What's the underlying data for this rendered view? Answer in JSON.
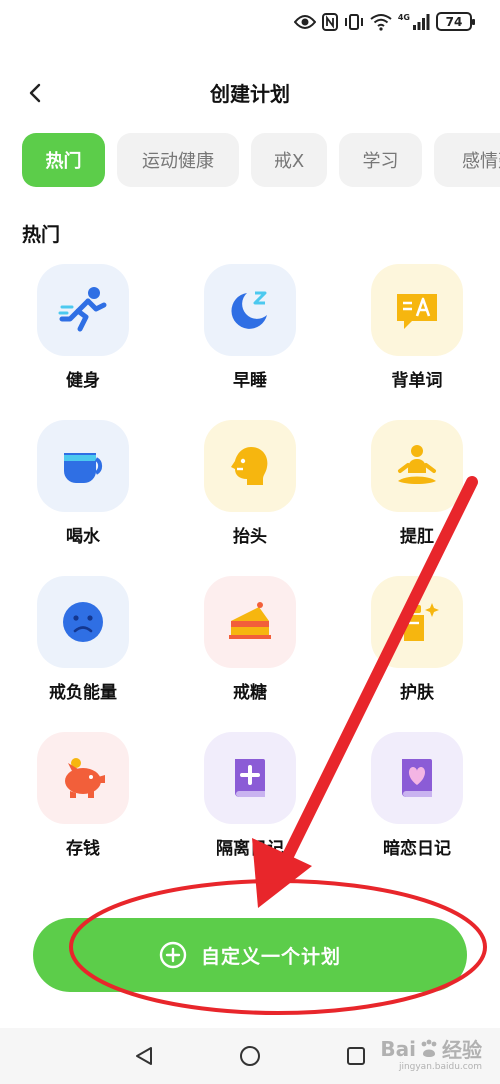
{
  "status_bar": {
    "battery": "74",
    "network": "4G"
  },
  "header": {
    "title": "创建计划"
  },
  "tabs": [
    {
      "label": "热门",
      "active": true
    },
    {
      "label": "运动健康",
      "active": false
    },
    {
      "label": "戒X",
      "active": false
    },
    {
      "label": "学习",
      "active": false
    },
    {
      "label": "感情建",
      "active": false
    }
  ],
  "section": {
    "title": "热门"
  },
  "plans": [
    {
      "label": "健身",
      "icon": "running-person-icon"
    },
    {
      "label": "早睡",
      "icon": "moon-sleep-icon"
    },
    {
      "label": "背单词",
      "icon": "translate-card-icon"
    },
    {
      "label": "喝水",
      "icon": "cup-icon"
    },
    {
      "label": "抬头",
      "icon": "head-profile-icon"
    },
    {
      "label": "提肛",
      "icon": "meditation-icon"
    },
    {
      "label": "戒负能量",
      "icon": "sad-face-icon"
    },
    {
      "label": "戒糖",
      "icon": "cake-icon"
    },
    {
      "label": "护肤",
      "icon": "lotion-bottle-icon"
    },
    {
      "label": "存钱",
      "icon": "piggy-bank-icon"
    },
    {
      "label": "隔离日记",
      "icon": "medical-book-icon"
    },
    {
      "label": "暗恋日记",
      "icon": "heart-book-icon"
    }
  ],
  "custom_plan": {
    "label": "自定义一个计划"
  },
  "watermark": {
    "brand_left": "Bai",
    "brand_right": "经验",
    "sub": "jingyan.baidu.com"
  },
  "colors": {
    "accent": "#5ccd4a",
    "annotation": "#e8262b"
  }
}
